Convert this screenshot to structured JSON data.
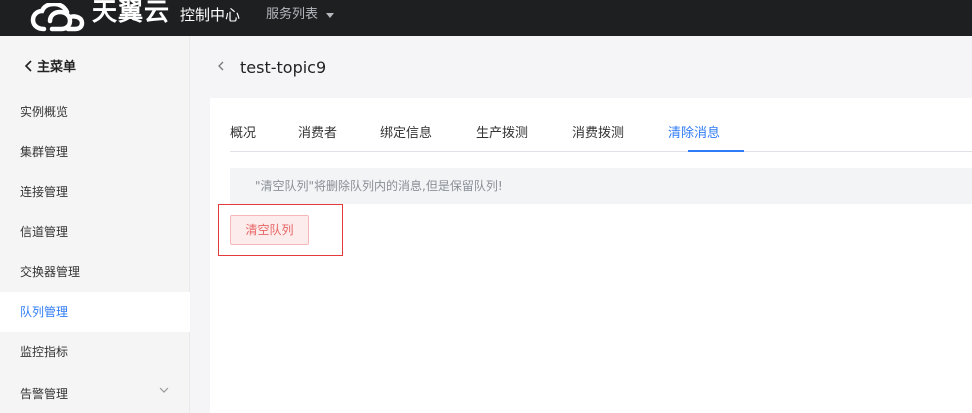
{
  "header": {
    "logo_text": "天翼云",
    "console_label": "控制中心",
    "services_label": "服务列表"
  },
  "sidebar": {
    "back_label": "主菜单",
    "items": [
      {
        "label": "实例概览"
      },
      {
        "label": "集群管理"
      },
      {
        "label": "连接管理"
      },
      {
        "label": "信道管理"
      },
      {
        "label": "交换器管理"
      },
      {
        "label": "队列管理",
        "active": true
      },
      {
        "label": "监控指标"
      },
      {
        "label": "告警管理"
      }
    ]
  },
  "page": {
    "title": "test-topic9"
  },
  "tabs": [
    {
      "label": "概况"
    },
    {
      "label": "消费者"
    },
    {
      "label": "绑定信息"
    },
    {
      "label": "生产拨测"
    },
    {
      "label": "消费拨测"
    },
    {
      "label": "清除消息",
      "active": true
    }
  ],
  "notice": {
    "text": "\"清空队列\"将删除队列内的消息,但是保留队列!"
  },
  "actions": {
    "clear_queue_label": "清空队列"
  },
  "colors": {
    "accent": "#2f7cf6",
    "danger": "#e86464",
    "topbar": "#1e1f21"
  }
}
